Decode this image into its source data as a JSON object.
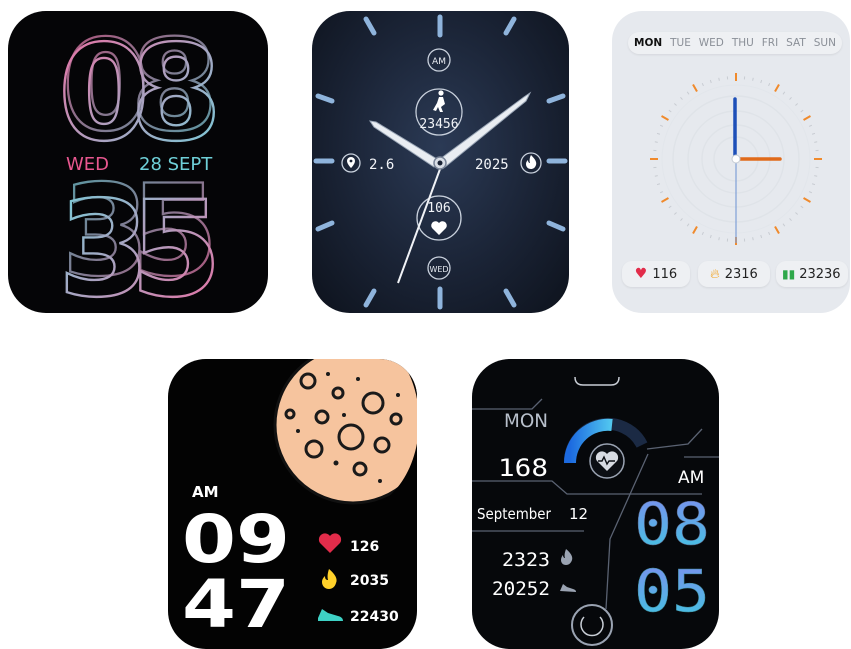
{
  "face1": {
    "hour": "08",
    "minute": "35",
    "day": "WED",
    "date": "28 SEPT"
  },
  "face2": {
    "ampm": "AM",
    "steps": "23456",
    "distance": "2.6",
    "calories": "2025",
    "heart": "106",
    "day": "WED"
  },
  "face3": {
    "days": [
      "MON",
      "TUE",
      "WED",
      "THU",
      "FRI",
      "SAT",
      "SUN"
    ],
    "heart": "116",
    "calories": "2316",
    "steps": "23236"
  },
  "face4": {
    "ampm": "AM",
    "hour": "09",
    "minute": "47",
    "heart": "126",
    "calories": "2035",
    "steps": "22430"
  },
  "face5": {
    "day": "MON",
    "heart": "168",
    "month": "September",
    "date": "12",
    "ampm": "AM",
    "calories": "2323",
    "steps": "20252",
    "hour": "08",
    "minute": "05"
  },
  "colors": {
    "pink": "#e8578f",
    "cyan": "#6fd0d8",
    "orange": "#f08a2c",
    "blue": "#1d4fb8",
    "moon": "#f6c49e",
    "yellow": "#ffd12a",
    "teal": "#3ed1c5",
    "red": "#e22c4a"
  }
}
